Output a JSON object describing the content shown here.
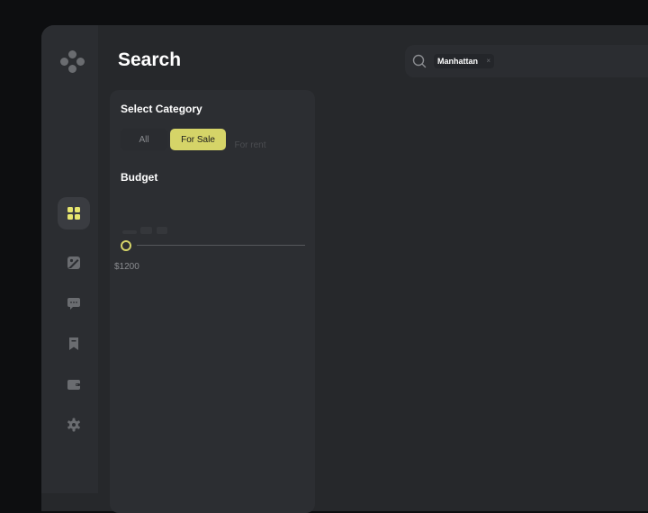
{
  "header": {
    "title": "Search"
  },
  "search": {
    "chip_label": "Manhattan",
    "chip_close": "×"
  },
  "filters": {
    "category_label": "Select Category",
    "categories": [
      {
        "label": "All",
        "selected": false
      },
      {
        "label": "For Sale",
        "selected": true
      },
      {
        "label": "For rent",
        "selected": false
      }
    ],
    "budget_label": "Budget",
    "budget_value": "$1200"
  },
  "sidebar": {
    "items": [
      {
        "icon": "grid-icon",
        "active": true
      },
      {
        "icon": "image-icon",
        "active": false
      },
      {
        "icon": "chat-icon",
        "active": false
      },
      {
        "icon": "bookmark-icon",
        "active": false
      },
      {
        "icon": "wallet-icon",
        "active": false
      },
      {
        "icon": "gear-icon",
        "active": false
      }
    ]
  },
  "colors": {
    "accent": "#d5d468",
    "background": "#26282b",
    "panel": "#2c2e32"
  }
}
